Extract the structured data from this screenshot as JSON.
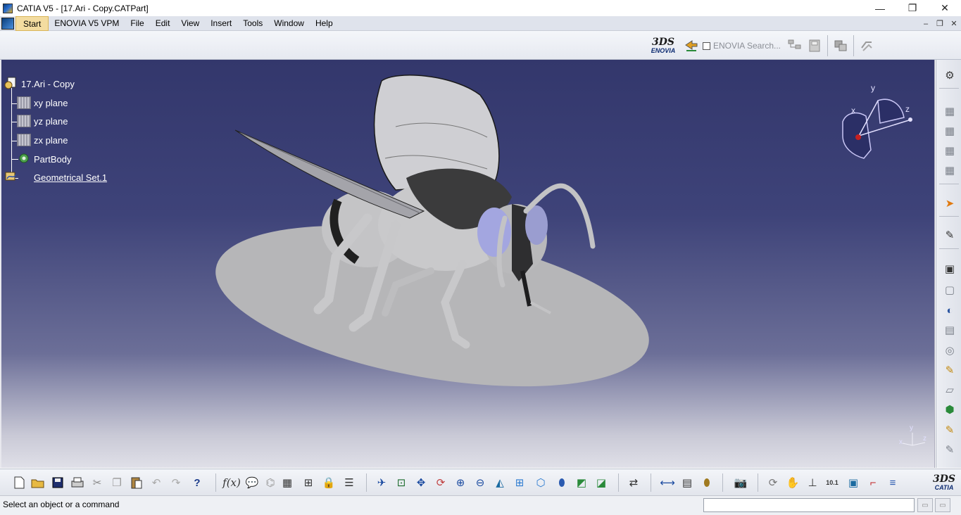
{
  "window": {
    "title": "CATIA V5 - [17.Ari - Copy.CATPart]",
    "minimize": "—",
    "maximize": "❐",
    "close": "✕"
  },
  "menu": {
    "items": [
      "Start",
      "ENOVIA V5 VPM",
      "File",
      "Edit",
      "View",
      "Insert",
      "Tools",
      "Window",
      "Help"
    ],
    "mdi": [
      "–",
      "❐",
      "✕"
    ]
  },
  "toolbar_top": {
    "enovia_logo_ds": "3DS",
    "enovia_logo_word": "ENOVIA",
    "enovia_search": "ENOVIA Search..."
  },
  "tree": {
    "root": "17.Ari - Copy",
    "items": [
      "xy plane",
      "yz plane",
      "zx plane",
      "PartBody",
      "Geometrical Set.1"
    ],
    "expander": "+"
  },
  "compass": {
    "x": "x",
    "y": "y",
    "z": "z"
  },
  "mini_axis": {
    "x": "x",
    "y": "y",
    "z": "z"
  },
  "bottom_logo": {
    "ds": "3DS",
    "word": "CATIA"
  },
  "status": {
    "message": "Select an object or a command",
    "buttons": [
      "▭",
      "▭"
    ]
  },
  "colors": {
    "viewport_top": "#33376c",
    "viewport_bottom": "#e0e0e8",
    "menu_active": "#f3dca0"
  }
}
